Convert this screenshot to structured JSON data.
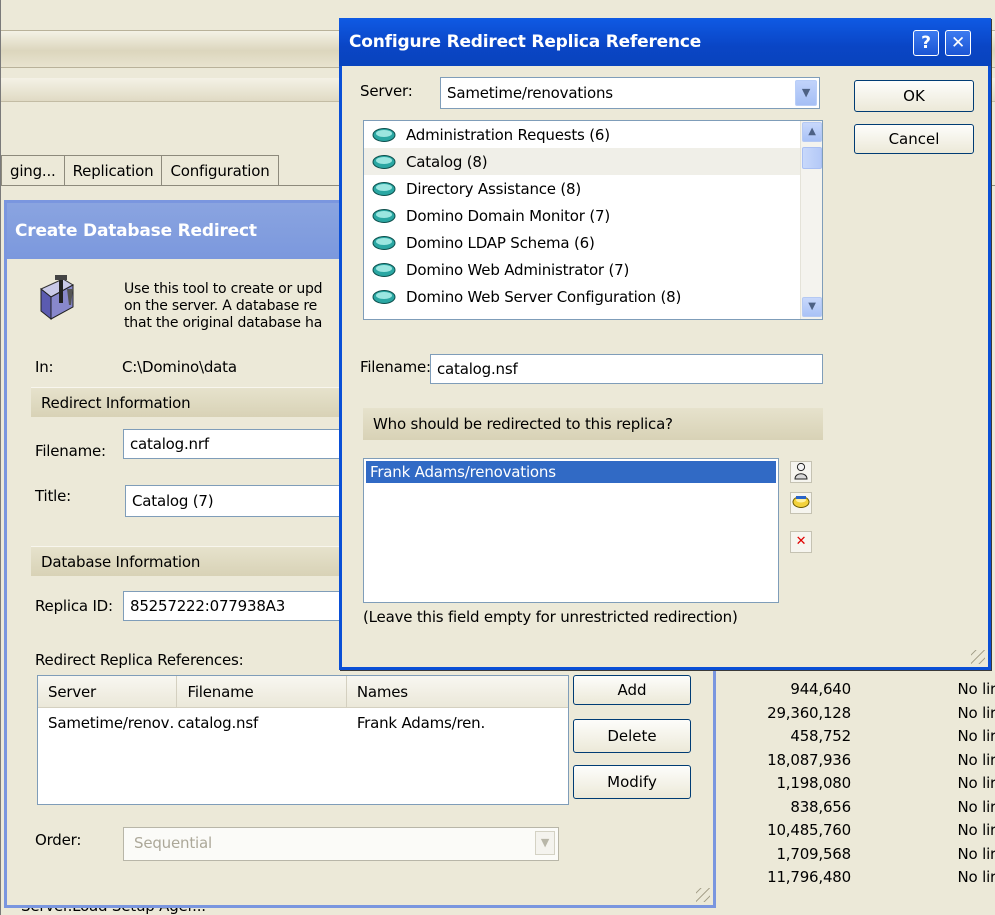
{
  "background": {
    "tabs": [
      "ging...",
      "Replication",
      "Configuration"
    ],
    "numbers": [
      "944,640",
      "29,360,128",
      "458,752",
      "18,087,936",
      "1,198,080",
      "838,656",
      "10,485,760",
      "1,709,568",
      "11,796,480"
    ],
    "limit_text": "No lir",
    "bottom_row_text": "Server.Load Setup Ager..."
  },
  "create_dialog": {
    "title": "Create Database Redirect",
    "description": [
      "Use this tool to create or upd",
      "on the server. A database re",
      "that the original database ha"
    ],
    "in_label": "In:",
    "in_value": "C:\\Domino\\data",
    "redirect_section": "Redirect Information",
    "filename_label": "Filename:",
    "filename_value": "catalog.nrf",
    "title_label": "Title:",
    "title_value": "Catalog (7)",
    "database_section": "Database Information",
    "replica_id_label": "Replica ID:",
    "replica_id_value": "85257222:077938A3",
    "references_label": "Redirect Replica References:",
    "columns": [
      "Server",
      "Filename",
      "Names"
    ],
    "rows": [
      {
        "server": "Sametime/renov․",
        "filename": "catalog.nsf",
        "names": "Frank Adams/ren․"
      }
    ],
    "buttons": {
      "add": "Add",
      "delete": "Delete",
      "modify": "Modify"
    },
    "order_label": "Order:",
    "order_value": "Sequential"
  },
  "configure_dialog": {
    "title": "Configure Redirect Replica Reference",
    "help_label": "?",
    "close_label": "✕",
    "server_label": "Server:",
    "server_value": "Sametime/renovations",
    "ok_label": "OK",
    "cancel_label": "Cancel",
    "databases": [
      "Administration Requests (6)",
      "Catalog (8)",
      "Directory Assistance (8)",
      "Domino Domain Monitor (7)",
      "Domino LDAP Schema (6)",
      "Domino Web Administrator (7)",
      "Domino Web Server Configuration (8)"
    ],
    "selected_database": "Catalog (8)",
    "filename_label": "Filename:",
    "filename_value": "catalog.nsf",
    "who_label": "Who should be redirected to this replica?",
    "names": [
      "Frank Adams/renovations"
    ],
    "hint": "(Leave this field empty for unrestricted redirection)"
  }
}
